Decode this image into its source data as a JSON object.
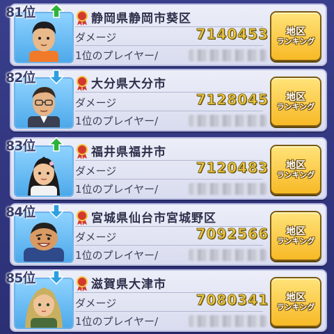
{
  "rows": [
    {
      "rank_number": "81",
      "rank_suffix": "位",
      "trend": "up",
      "region": "静岡県静岡市葵区",
      "damage_label": "ダメージ",
      "damage": "7140453",
      "top_player_label": "1位のプレイヤー/",
      "button_line1": "地区",
      "button_line2": "ランキング"
    },
    {
      "rank_number": "82",
      "rank_suffix": "位",
      "trend": "down",
      "region": "大分県大分市",
      "damage_label": "ダメージ",
      "damage": "7128045",
      "top_player_label": "1位のプレイヤー/",
      "button_line1": "地区",
      "button_line2": "ランキング"
    },
    {
      "rank_number": "83",
      "rank_suffix": "位",
      "trend": "up",
      "region": "福井県福井市",
      "damage_label": "ダメージ",
      "damage": "7120483",
      "top_player_label": "1位のプレイヤー/",
      "button_line1": "地区",
      "button_line2": "ランキング"
    },
    {
      "rank_number": "84",
      "rank_suffix": "位",
      "trend": "down",
      "region": "宮城県仙台市宮城野区",
      "damage_label": "ダメージ",
      "damage": "7092566",
      "top_player_label": "1位のプレイヤー/",
      "button_line1": "地区",
      "button_line2": "ランキング"
    },
    {
      "rank_number": "85",
      "rank_suffix": "位",
      "trend": "down",
      "region": "滋賀県大津市",
      "damage_label": "ダメージ",
      "damage": "7080341",
      "top_player_label": "1位のプレイヤー/",
      "button_line1": "地区",
      "button_line2": "ランキング"
    }
  ],
  "colors": {
    "trend_up": "#2fb23a",
    "trend_down": "#2d9fe0",
    "damage_gold": "#e9c640",
    "button_gold": "#f7b926"
  }
}
